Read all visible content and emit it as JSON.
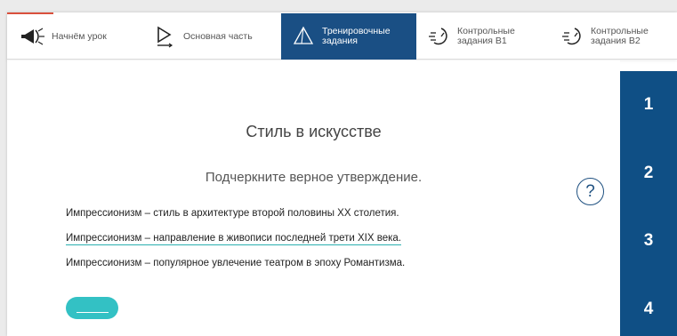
{
  "nav": {
    "items": [
      {
        "label": "Начнём урок",
        "icon": "megaphone-icon",
        "active": false
      },
      {
        "label": "Основная часть",
        "icon": "play-icon",
        "active": false
      },
      {
        "label": "Тренировочные задания",
        "icon": "pyramid-icon",
        "active": true
      },
      {
        "label": "Контрольные задания В1",
        "icon": "timer-icon",
        "active": false
      },
      {
        "label": "Контрольные задания В2",
        "icon": "timer-icon",
        "active": false
      }
    ]
  },
  "lesson": {
    "title": "Стиль в искусстве",
    "instruction": "Подчеркните верное утверждение.",
    "statements": [
      {
        "text": "Импрессионизм – стиль в архитектуре второй половины XX столетия.",
        "underlined": false
      },
      {
        "text": "Импрессионизм – направление в живописи последней трети XIX века.",
        "underlined": true
      },
      {
        "text": "Импрессионизм – популярное увлечение театром в эпоху Романтизма.",
        "underlined": false
      }
    ],
    "help_symbol": "?"
  },
  "side": {
    "numbers": [
      "1",
      "2",
      "3",
      "4"
    ]
  },
  "colors": {
    "accent": "#d9503c",
    "nav_active": "#1a4f84",
    "side_panel": "#0f4f85",
    "check_button": "#33c1c4",
    "underline": "#2ab0b0"
  }
}
